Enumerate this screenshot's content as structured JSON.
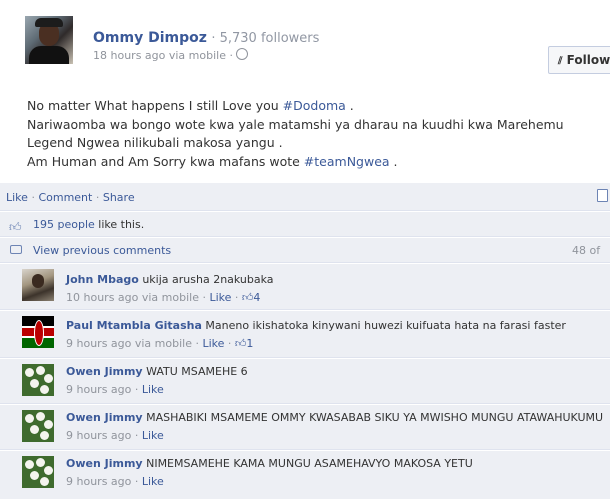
{
  "post": {
    "author": "Ommy Dimpoz",
    "followers": "5,730 followers",
    "meta": "18 hours ago via mobile",
    "follow_label": "Follow",
    "lines": [
      {
        "text": "No matter What happens I still Love you ",
        "hashtag": "#Dodoma",
        "after": " ."
      },
      {
        "text": "Nariwaomba wa bongo wote kwa yale matamshi ya dharau na kuudhi kwa Marehemu",
        "hashtag": "",
        "after": ""
      },
      {
        "text": "Legend Ngwea nilikubali makosa yangu .",
        "hashtag": "",
        "after": ""
      },
      {
        "text": "Am Human and Am Sorry kwa mafans wote ",
        "hashtag": "#teamNgwea",
        "after": " ."
      }
    ]
  },
  "actions": {
    "like": "Like",
    "comment": "Comment",
    "share": "Share"
  },
  "likes": {
    "people": "195 people",
    "suffix": " like this."
  },
  "previous": {
    "label": "View previous comments",
    "count": "48 of"
  },
  "comments": [
    {
      "author": "John Mbago",
      "text": " ukija arusha 2nakubaka",
      "meta": "10 hours ago via mobile",
      "like": "Like",
      "likes": "4"
    },
    {
      "author": "Paul Mtambla Gitasha",
      "text": " Maneno ikishatoka kinywani huwezi kuifuata hata na farasi faster",
      "meta": "9 hours ago via mobile",
      "like": "Like",
      "likes": "1"
    },
    {
      "author": "Owen Jimmy",
      "text": " WATU MSAMEHE 6",
      "meta": "9 hours ago",
      "like": "Like",
      "likes": ""
    },
    {
      "author": "Owen Jimmy",
      "text": " MASHABIKI MSAMEME OMMY KWASABAB SIKU YA MWISHO MUNGU ATAWAHUKUMU",
      "meta": "9 hours ago",
      "like": "Like",
      "likes": ""
    },
    {
      "author": "Owen Jimmy",
      "text": " NIMEMSAMEHE KAMA MUNGU ASAMEHAVYO MAKOSA YETU",
      "meta": "9 hours ago",
      "like": "Like",
      "likes": ""
    }
  ],
  "colors": {
    "link": "#3b5998",
    "feedback_bg": "#edeff4",
    "muted": "#90949c"
  },
  "icons": {
    "globe": "globe-icon",
    "rss": "rss-icon",
    "thumbs_up": "thumbs-up-icon",
    "comment_bubble": "comment-bubble-icon"
  }
}
